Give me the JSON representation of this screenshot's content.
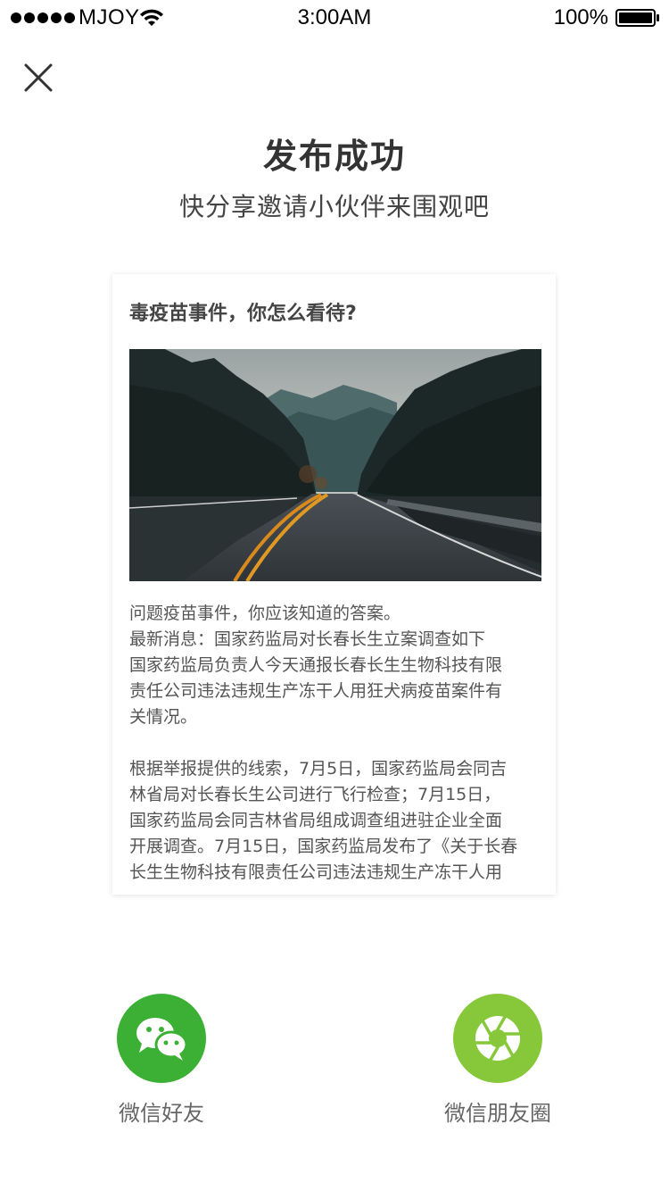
{
  "status_bar": {
    "carrier": "MJOY",
    "time": "3:00AM",
    "battery": "100%"
  },
  "header": {
    "close_icon": "close-icon"
  },
  "title": "发布成功",
  "subtitle": "快分享邀请小伙伴来围观吧",
  "card": {
    "title": "毒疫苗事件，你怎么看待?",
    "image": "mountain-road-photo",
    "paragraphs": [
      [
        "问题疫苗事件，你应该知道的答案。",
        "最新消息：国家药监局对长春长生立案调查如下",
        "国家药监局负责人今天通报长春长生生物科技有限",
        "责任公司违法违规生产冻干人用狂犬病疫苗案件有",
        "关情况。"
      ],
      [
        "根据举报提供的线索，7月5日，国家药监局会同吉",
        "林省局对长春长生公司进行飞行检查；7月15日，",
        "国家药监局会同吉林省局组成调查组进驻企业全面",
        "开展调查。7月15日，国家药监局发布了《关于长春",
        "长生生物科技有限责任公司违法违规生产冻干人用"
      ]
    ]
  },
  "share": {
    "wechat": {
      "label": "微信好友",
      "icon": "wechat-icon",
      "color": "#3bb034"
    },
    "moments": {
      "label": "微信朋友圈",
      "icon": "moments-icon",
      "color": "#87c83a"
    }
  }
}
